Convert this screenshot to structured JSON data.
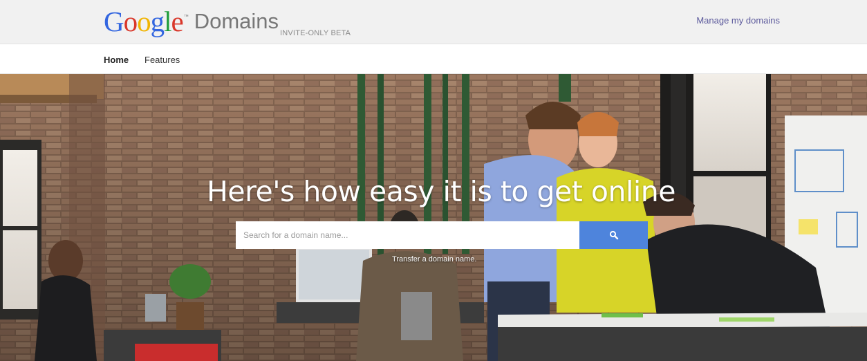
{
  "header": {
    "logo_letters": [
      "G",
      "o",
      "o",
      "g",
      "l",
      "e"
    ],
    "logo_tm": "™",
    "product_name": "Domains",
    "beta_label": "INVITE-ONLY BETA",
    "manage_link": "Manage my domains"
  },
  "nav": {
    "items": [
      {
        "label": "Home",
        "active": true
      },
      {
        "label": "Features",
        "active": false
      }
    ]
  },
  "hero": {
    "title": "Here's how easy it is to get online",
    "search_placeholder": "Search for a domain name...",
    "search_icon": "search-icon",
    "transfer_link": "Transfer a domain name."
  },
  "colors": {
    "g_blue": "#3366e0",
    "g_red": "#d9372a",
    "g_yellow": "#f1b400",
    "g_green": "#1f9d3b",
    "search_button": "#4e84dc",
    "manage_link": "#5c5a9c"
  }
}
